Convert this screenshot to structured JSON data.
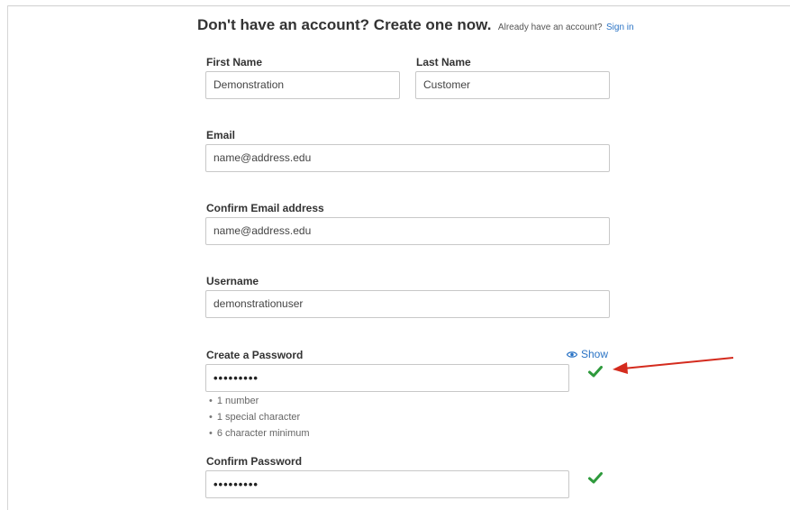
{
  "header": {
    "title": "Don't have an account? Create one now.",
    "subtitle": "Already have an account?",
    "signin_link": "Sign in"
  },
  "form": {
    "first_name": {
      "label": "First Name",
      "value": "Demonstration"
    },
    "last_name": {
      "label": "Last Name",
      "value": "Customer"
    },
    "email": {
      "label": "Email",
      "value": "name@address.edu"
    },
    "confirm_email": {
      "label": "Confirm Email address",
      "value": "name@address.edu"
    },
    "username": {
      "label": "Username",
      "value": "demonstrationuser"
    },
    "password": {
      "label": "Create a Password",
      "value": "•••••••••",
      "show_label": "Show",
      "valid": true
    },
    "password_rules": [
      "1 number",
      "1 special character",
      "6 character minimum"
    ],
    "confirm_password": {
      "label": "Confirm Password",
      "value": "•••••••••",
      "valid": true
    }
  },
  "icons": {
    "show": "eye-icon",
    "valid": "checkmark-icon",
    "annotation": "red-arrow-icon"
  },
  "colors": {
    "link": "#2a73c5",
    "check": "#2e9a3c",
    "arrow": "#d42b1e"
  }
}
